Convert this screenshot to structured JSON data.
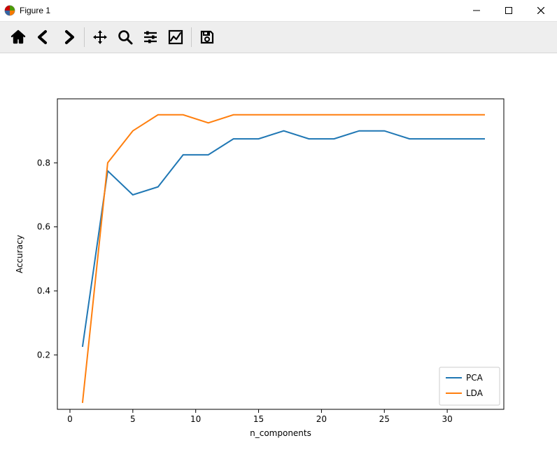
{
  "window": {
    "title": "Figure 1"
  },
  "toolbar": {
    "home": "Home",
    "back": "Back",
    "forward": "Forward",
    "pan": "Pan",
    "zoom": "Zoom",
    "subplots": "Configure subplots",
    "edit": "Edit",
    "save": "Save"
  },
  "chart_data": {
    "type": "line",
    "xlabel": "n_components",
    "ylabel": "Accuracy",
    "title": "",
    "xlim": [
      -1,
      34.5
    ],
    "ylim": [
      0.03,
      1.0
    ],
    "xticks": [
      0,
      5,
      10,
      15,
      20,
      25,
      30
    ],
    "yticks": [
      0.2,
      0.4,
      0.6,
      0.8
    ],
    "x": [
      1,
      3,
      5,
      7,
      9,
      11,
      13,
      15,
      17,
      19,
      21,
      23,
      25,
      27,
      29,
      31,
      33
    ],
    "series": [
      {
        "name": "PCA",
        "color": "#1f77b4",
        "values": [
          0.225,
          0.775,
          0.7,
          0.725,
          0.825,
          0.825,
          0.875,
          0.875,
          0.9,
          0.875,
          0.875,
          0.9,
          0.9,
          0.875,
          0.875,
          0.875,
          0.875
        ]
      },
      {
        "name": "LDA",
        "color": "#ff7f0e",
        "values": [
          0.05,
          0.8,
          0.9,
          0.95,
          0.95,
          0.925,
          0.95,
          0.95,
          0.95,
          0.95,
          0.95,
          0.95,
          0.95,
          0.95,
          0.95,
          0.95,
          0.95
        ]
      }
    ],
    "legend": {
      "items": [
        "PCA",
        "LDA"
      ],
      "position": "lower right"
    }
  }
}
